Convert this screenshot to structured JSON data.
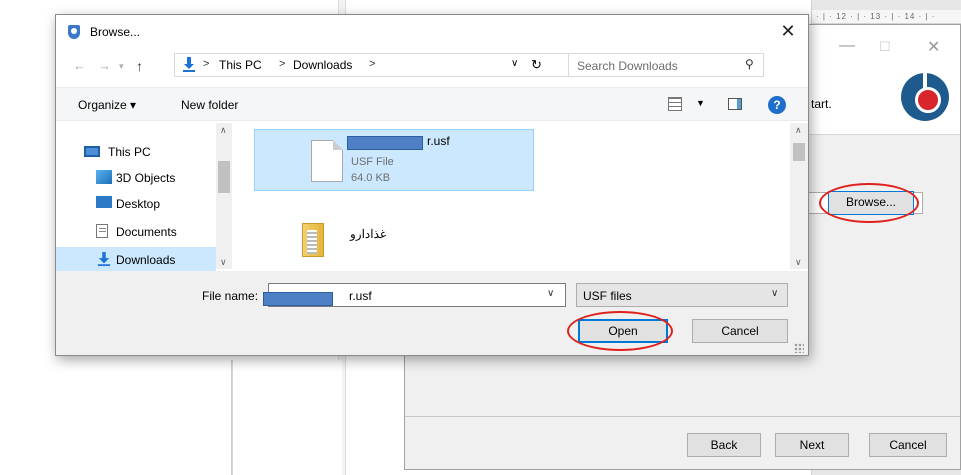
{
  "ruler": {
    "text": "· | · 12 · | · 13 · | · 14 · | ·"
  },
  "installer": {
    "minimize_glyph": "—",
    "maximize_glyph": "☐",
    "close_glyph": "✕",
    "instruction_text": "tart.",
    "browse_label": "Browse...",
    "back_label": "Back",
    "next_label": "Next",
    "cancel_label": "Cancel"
  },
  "dialog": {
    "title": "Browse...",
    "close_glyph": "✕",
    "address": {
      "crumbs": [
        "This PC",
        "Downloads"
      ],
      "separator": ">"
    },
    "search_placeholder": "Search Downloads",
    "toolbar": {
      "organize_label": "Organize ▾",
      "new_folder_label": "New folder",
      "help_label": "?"
    },
    "nav_items": [
      {
        "label": "This PC"
      },
      {
        "label": "3D Objects"
      },
      {
        "label": "Desktop"
      },
      {
        "label": "Documents"
      },
      {
        "label": "Downloads",
        "selected": true
      }
    ],
    "files": [
      {
        "name": "r.usf",
        "type": "USF File",
        "size": "64.0 KB",
        "selected": true
      },
      {
        "name": "غذادارو"
      }
    ],
    "file_name_label": "File name:",
    "file_name_value": "r.usf",
    "file_type_value": "USF files",
    "open_label": "Open",
    "cancel_label": "Cancel"
  },
  "colors": {
    "selection": "#cce8ff",
    "accent": "#0078d7",
    "annotation": "#e0201b",
    "redaction": "#4f7fc4"
  },
  "icons": [
    "shield-icon",
    "back-arrow-icon",
    "forward-arrow-icon",
    "up-arrow-icon",
    "download-icon",
    "refresh-icon",
    "search-icon",
    "view-options-icon",
    "preview-pane-icon",
    "help-icon",
    "computer-icon",
    "3d-objects-icon",
    "desktop-icon",
    "documents-icon",
    "file-icon",
    "folder-icon"
  ]
}
